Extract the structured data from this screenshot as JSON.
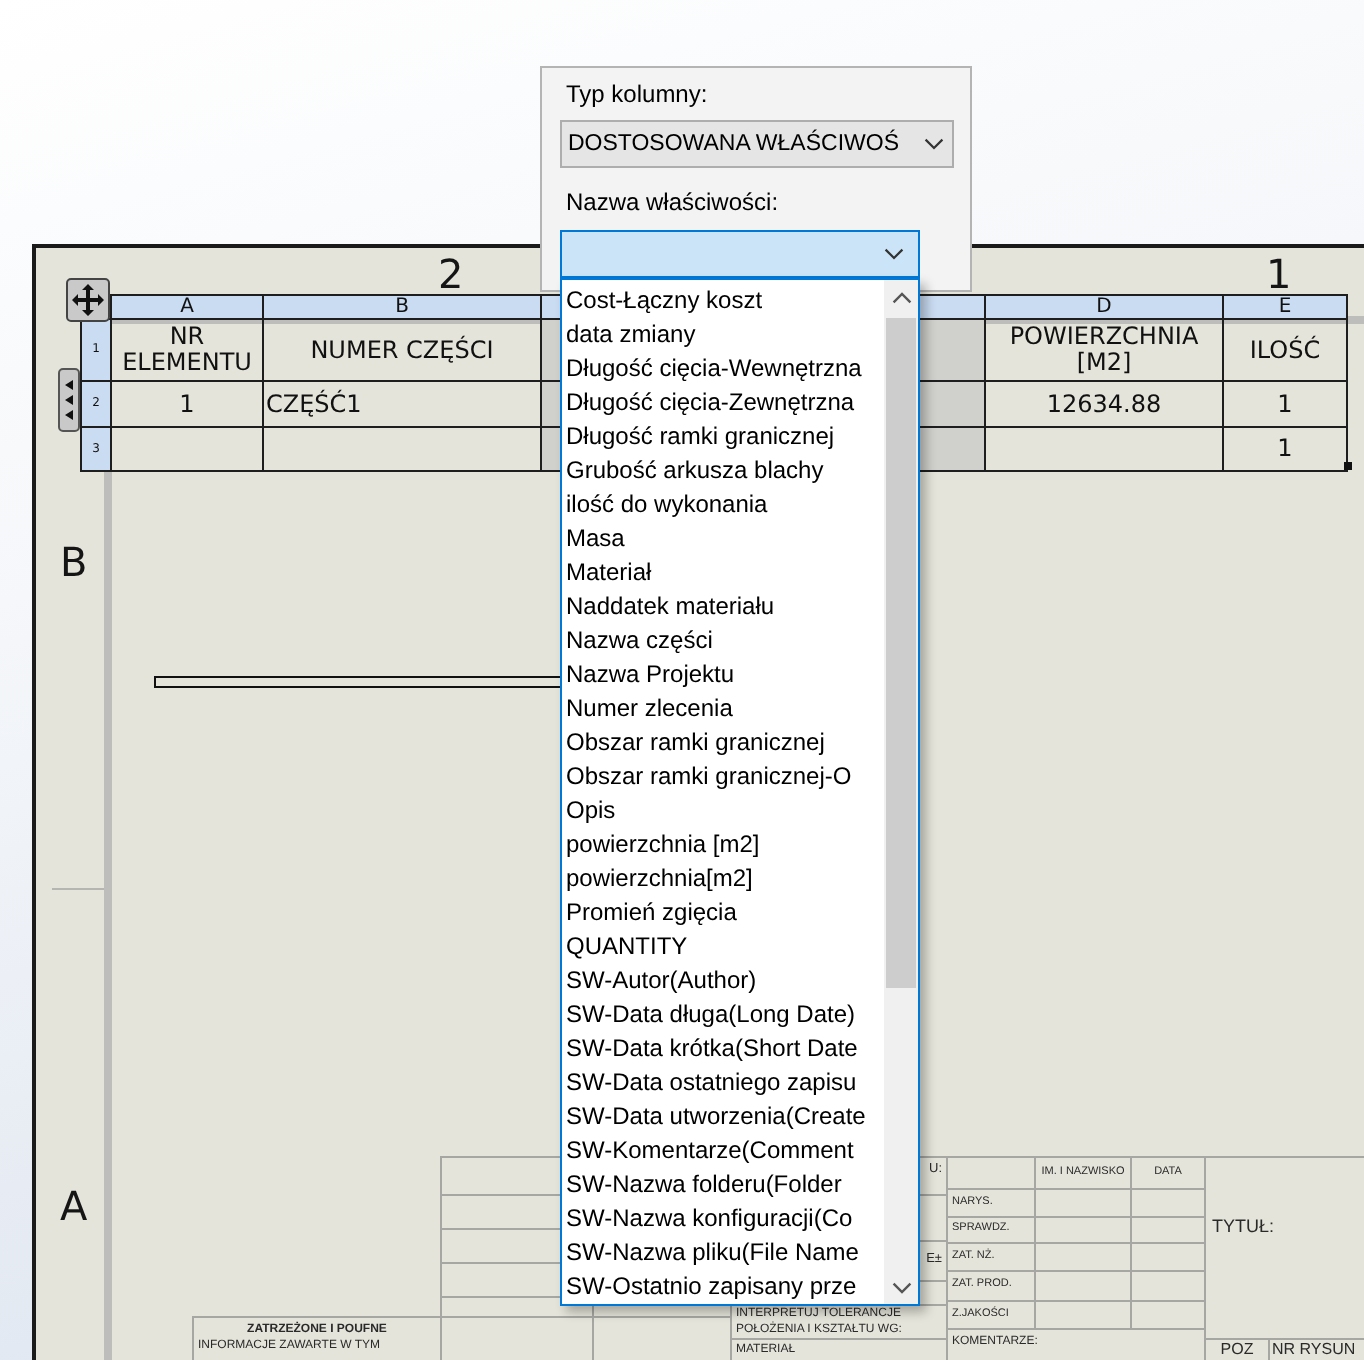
{
  "sheet": {
    "zones": {
      "columns": [
        "2",
        "1"
      ],
      "rows": [
        "B",
        "A"
      ]
    }
  },
  "bom_table": {
    "columns": [
      {
        "letter": "A",
        "selected": false
      },
      {
        "letter": "B",
        "selected": false
      },
      {
        "selected": true
      },
      {
        "letter": "D",
        "selected": false
      },
      {
        "letter": "E",
        "selected": false
      }
    ],
    "rows": [
      {
        "number": "1",
        "cells": [
          "NR ELEMENTU",
          "NUMER CZĘŚCI",
          null,
          "POWIERZCHNIA [M2]",
          "ILOŚĆ"
        ]
      },
      {
        "number": "2",
        "cells": [
          "1",
          "CZĘŚĆ1",
          null,
          "12634.88",
          "1"
        ]
      },
      {
        "number": "3",
        "cells": [
          null,
          null,
          null,
          null,
          "1"
        ]
      }
    ]
  },
  "column_properties": {
    "column_type": {
      "label": "Typ kolumny:",
      "value": "DOSTOSOWANA WŁAŚCIWOŚ"
    },
    "property_name": {
      "label": "Nazwa właściwości:",
      "expanded": true,
      "options": [
        {
          "label": "Cost-Łączny koszt",
          "selected": false
        },
        {
          "label": "data zmiany",
          "selected": false
        },
        {
          "label": "Długość cięcia-Wewnętrzna",
          "selected": false
        },
        {
          "label": "Długość cięcia-Zewnętrzna",
          "selected": false
        },
        {
          "label": "Długość ramki granicznej",
          "selected": false
        },
        {
          "label": "Grubość arkusza blachy",
          "selected": false
        },
        {
          "label": "ilość do wykonania",
          "selected": false
        },
        {
          "label": "Masa",
          "selected": false
        },
        {
          "label": "Materiał",
          "selected": false
        },
        {
          "label": "Naddatek materiału",
          "selected": false
        },
        {
          "label": "Nazwa części",
          "selected": false
        },
        {
          "label": "Nazwa Projektu",
          "selected": false
        },
        {
          "label": "Numer zlecenia",
          "selected": false
        },
        {
          "label": "Obszar ramki granicznej",
          "selected": false
        },
        {
          "label": "Obszar ramki granicznej-O",
          "selected": false
        },
        {
          "label": "Opis",
          "selected": false
        },
        {
          "label": "powierzchnia [m2]",
          "selected": false
        },
        {
          "label": "powierzchnia[m2]",
          "selected": false
        },
        {
          "label": "Promień zgięcia",
          "selected": false
        },
        {
          "label": "QUANTITY",
          "selected": false
        },
        {
          "label": "SW-Autor(Author)",
          "selected": false
        },
        {
          "label": "SW-Data długa(Long Date)",
          "selected": false
        },
        {
          "label": "SW-Data krótka(Short Date",
          "selected": false
        },
        {
          "label": "SW-Data ostatniego zapisu",
          "selected": false
        },
        {
          "label": "SW-Data utworzenia(Create",
          "selected": false
        },
        {
          "label": "SW-Komentarze(Comment",
          "selected": false
        },
        {
          "label": "SW-Nazwa folderu(Folder",
          "selected": false
        },
        {
          "label": "SW-Nazwa konfiguracji(Co",
          "selected": false
        },
        {
          "label": "SW-Nazwa pliku(File Name",
          "selected": false
        },
        {
          "label": "SW-Ostatnio zapisany prze",
          "selected": false
        }
      ]
    }
  },
  "title_block": {
    "notice": {
      "title": "ZATRZEŻONE I POUFNE",
      "text": "INFORMACJE ZAWARTE W TYM"
    },
    "cut_labels": [
      "U:",
      "E±"
    ],
    "tolerance_note": [
      "INTERPRETUJ TOLERANCJE",
      "POŁOŻENIA I KSZTAŁTU WG:"
    ],
    "material_label": "MATERIAŁ",
    "approvals": {
      "columns": [
        "IM. I NAZWISKO",
        "DATA"
      ],
      "rows": [
        "NARYS.",
        "SPRAWDZ.",
        "ZAT. NŻ.",
        "ZAT. PROD.",
        "Z.JAKOŚCI"
      ]
    },
    "comments_label": "KOMENTARZE:",
    "title_label": "TYTUŁ:",
    "position_label": "POZ",
    "drawing_number_label": "NR RYSUN"
  }
}
